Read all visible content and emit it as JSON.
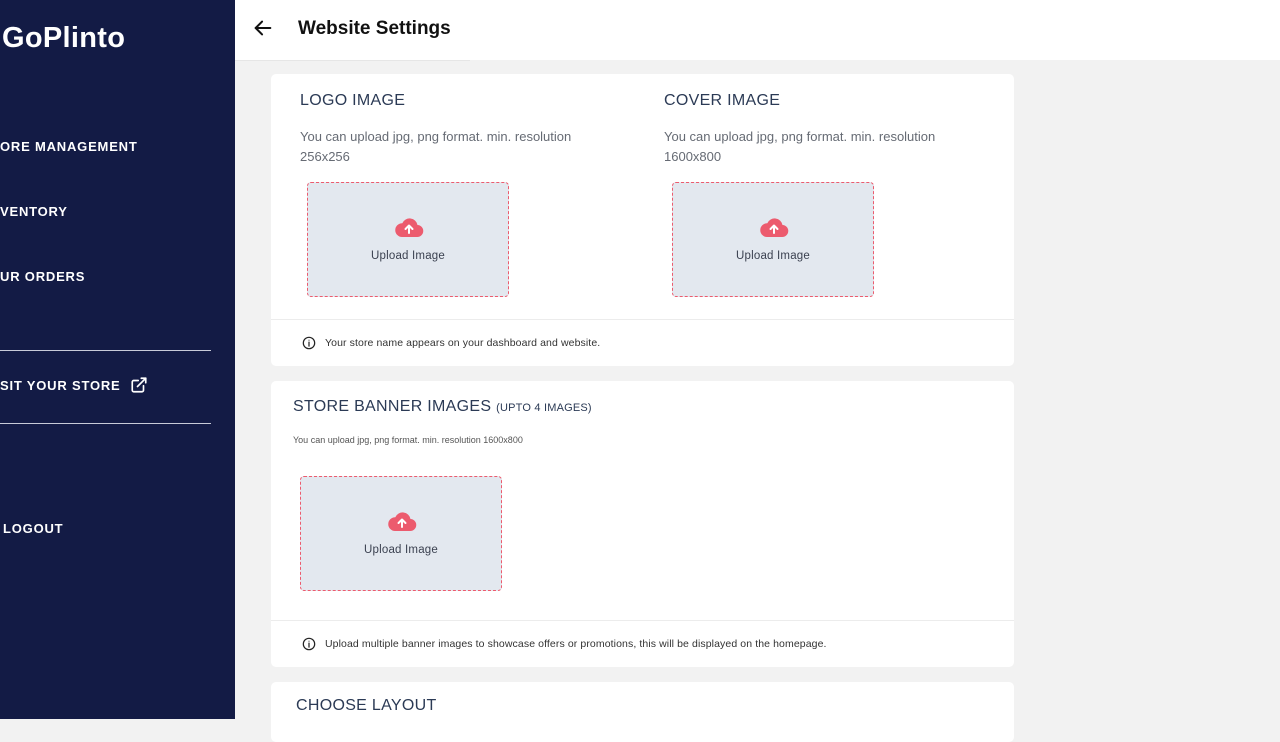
{
  "sidebar": {
    "brand": "GoPlinto",
    "items": [
      {
        "label": "ORE MANAGEMENT"
      },
      {
        "label": "VENTORY"
      },
      {
        "label": "UR ORDERS"
      },
      {
        "label": "SIT YOUR STORE"
      },
      {
        "label": "LOGOUT"
      }
    ]
  },
  "header": {
    "title": "Website Settings"
  },
  "logo_section": {
    "heading": "LOGO IMAGE",
    "hint": "You can upload jpg, png format. min. resolution 256x256",
    "upload_label": "Upload Image"
  },
  "cover_section": {
    "heading": "COVER IMAGE",
    "hint": "You can upload jpg, png format. min. resolution 1600x800",
    "upload_label": "Upload Image"
  },
  "logo_info": "Your store name appears on your dashboard and website.",
  "banner_section": {
    "heading": "STORE BANNER IMAGES",
    "heading_note": "(UPTO 4 IMAGES)",
    "hint": "You can upload jpg, png format. min. resolution 1600x800",
    "upload_label": "Upload Image",
    "info": "Upload multiple banner images to showcase offers or promotions, this will be displayed on the homepage."
  },
  "layout_section": {
    "heading": "CHOOSE LAYOUT"
  },
  "colors": {
    "sidebar_bg": "#131b45",
    "accent": "#ec5b6e",
    "upload_bg": "#e3e8ef"
  }
}
